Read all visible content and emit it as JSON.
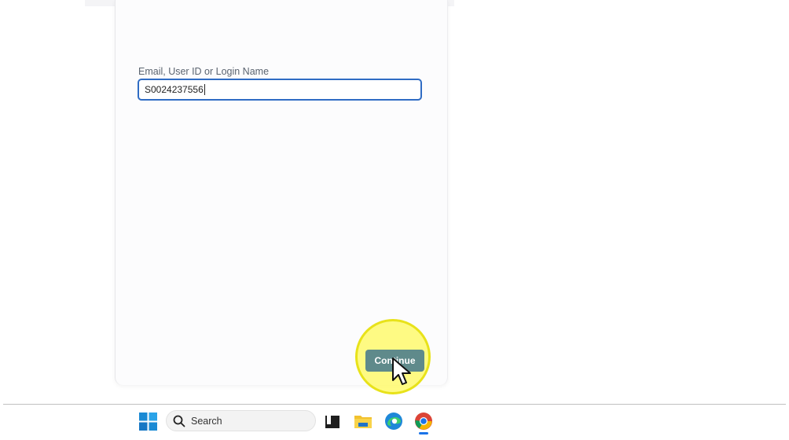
{
  "login": {
    "field_label": "Email, User ID or Login Name",
    "field_value": "S0024237556",
    "continue_label": "Continue"
  },
  "taskbar": {
    "search_placeholder": "Search",
    "apps": [
      {
        "name": "terminal",
        "icon": "terminal-icon"
      },
      {
        "name": "file-explorer",
        "icon": "folder-icon"
      },
      {
        "name": "edge",
        "icon": "edge-icon"
      },
      {
        "name": "chrome",
        "icon": "chrome-icon",
        "active": true
      }
    ]
  },
  "colors": {
    "field_border": "#2f6cc4",
    "button_bg": "#5f8a8b",
    "click_highlight": "#fff85a"
  }
}
